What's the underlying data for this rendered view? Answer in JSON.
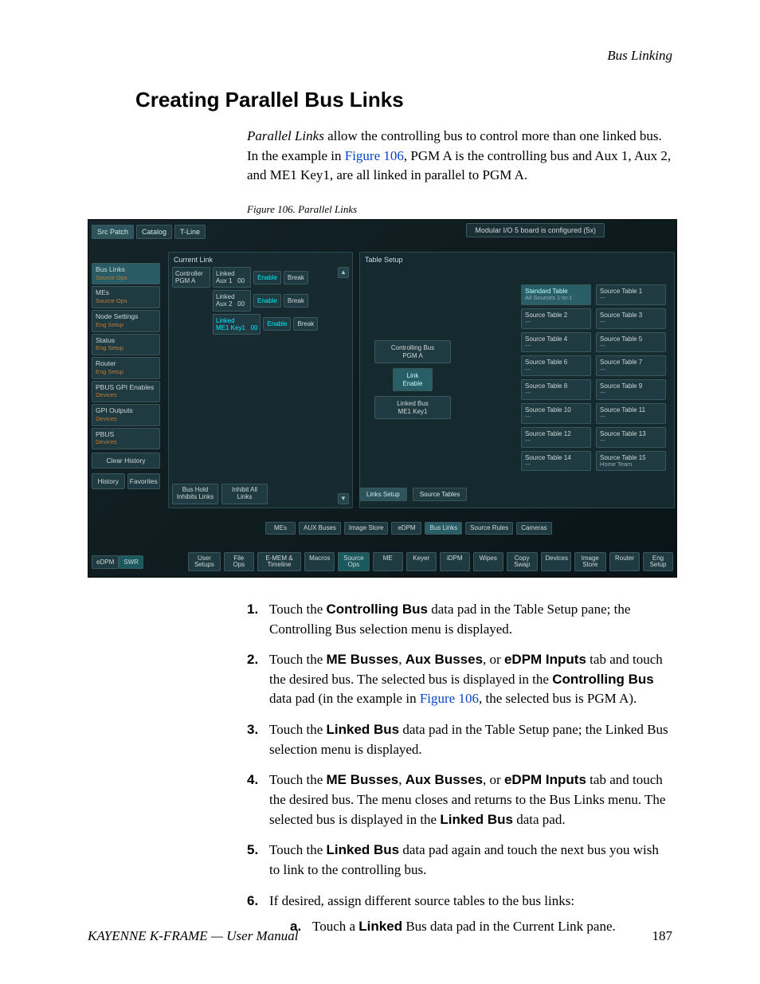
{
  "running_header": "Bus Linking",
  "section_title": "Creating Parallel Bus Links",
  "intro_parts": {
    "lead_italic": "Parallel Links",
    "after_lead": " allow the controlling bus to control more than one linked bus. In the example in ",
    "figref": "Figure 106",
    "after_figref": ", PGM A is the controlling bus and Aux 1, Aux 2, and ME1 Key1, are all linked in parallel to PGM A."
  },
  "figcaption": "Figure 106.  Parallel Links",
  "footer": {
    "left": "KAYENNE K-FRAME — User Manual",
    "right": "187"
  },
  "ui": {
    "topbar_tabs": [
      "Src Patch",
      "Catalog",
      "T-Line"
    ],
    "io_banner": "Modular I/O 5 board is configured (5x)",
    "sidebar": [
      {
        "name": "Bus Links",
        "sub": "Source Ops",
        "sel": true
      },
      {
        "name": "MEs",
        "sub": "Source Ops"
      },
      {
        "name": "Node Settings",
        "sub": "Eng Setup"
      },
      {
        "name": "Status",
        "sub": "Eng Setup"
      },
      {
        "name": "Router",
        "sub": "Eng Setup"
      },
      {
        "name": "PBUS GPI Enables",
        "sub": "Devices"
      },
      {
        "name": "GPI Outputs",
        "sub": "Devices"
      },
      {
        "name": "PBUS",
        "sub": "Devices"
      }
    ],
    "sidebar_footer": {
      "clear": "Clear History",
      "history": "History",
      "favorites": "Favorites"
    },
    "currentlink": {
      "label": "Current Link",
      "controller": {
        "title": "Controller",
        "bus": "PGM A"
      },
      "rows": [
        {
          "title": "Linked",
          "bus": "Aux 1",
          "idx": "00",
          "enable": "Enable",
          "break": "Break"
        },
        {
          "title": "Linked",
          "bus": "Aux 2",
          "idx": "00",
          "enable": "Enable",
          "break": "Break"
        },
        {
          "title": "Linked",
          "bus": "ME1 Key1",
          "idx": "00",
          "enable": "Enable",
          "break": "Break"
        }
      ],
      "footer": {
        "bushold": "Bus Hold Inhibits Links",
        "inhibit": "Inhibit All Links"
      }
    },
    "tablesetup": {
      "label": "Table Setup",
      "controlling": {
        "title": "Controlling Bus",
        "bus": "PGM A"
      },
      "link_enable": "Link Enable",
      "linkedbus": {
        "title": "Linked Bus",
        "bus": "ME1 Key1"
      },
      "source_tables": [
        {
          "name": "Standard Table",
          "sub": "All Sources 1-to-1",
          "sel": true
        },
        {
          "name": "Source Table 1",
          "sub": "---"
        },
        {
          "name": "Source Table 2",
          "sub": "---"
        },
        {
          "name": "Source Table 3",
          "sub": "---"
        },
        {
          "name": "Source Table 4",
          "sub": "---"
        },
        {
          "name": "Source Table 5",
          "sub": "---"
        },
        {
          "name": "Source Table 6",
          "sub": "---"
        },
        {
          "name": "Source Table 7",
          "sub": "---"
        },
        {
          "name": "Source Table 8",
          "sub": "---"
        },
        {
          "name": "Source Table 9",
          "sub": "---"
        },
        {
          "name": "Source Table 10",
          "sub": "---"
        },
        {
          "name": "Source Table 11",
          "sub": "---"
        },
        {
          "name": "Source Table 12",
          "sub": "---"
        },
        {
          "name": "Source Table 13",
          "sub": "---"
        },
        {
          "name": "Source Table 14",
          "sub": "---"
        },
        {
          "name": "Source Table 15",
          "sub": "Home Team"
        }
      ],
      "lower_tabs": [
        "Links Setup",
        "Source Tables"
      ]
    },
    "rowtabs": [
      "MEs",
      "AUX Buses",
      "Image Store",
      "eDPM",
      "Bus Links",
      "Source Rules",
      "Cameras"
    ],
    "rowtabs_sel": "Bus Links",
    "bottom_left": [
      "eDPM",
      "SWR"
    ],
    "bottom_right": [
      "User Setups",
      "File Ops",
      "E-MEM & Timeline",
      "Macros",
      "Source Ops",
      "ME",
      "Keyer",
      "iDPM",
      "Wipes",
      "Copy Swap",
      "Devices",
      "Image Store",
      "Router",
      "Eng Setup"
    ],
    "bottom_sel": "Source Ops"
  },
  "steps": [
    {
      "n": "1.",
      "parts": [
        "Touch the ",
        {
          "b": "Controlling Bus"
        },
        " data pad in the Table Setup pane; the Controlling Bus selection menu is displayed."
      ]
    },
    {
      "n": "2.",
      "parts": [
        "Touch the ",
        {
          "b": "ME Busses"
        },
        ", ",
        {
          "b": "Aux Busses"
        },
        ", or ",
        {
          "b": "eDPM Inputs"
        },
        " tab and touch the desired bus. The selected bus is displayed in the ",
        {
          "b": "Controlling Bus"
        },
        " data pad (in the example in ",
        {
          "a": "Figure 106"
        },
        ", the selected bus is PGM A)."
      ]
    },
    {
      "n": "3.",
      "parts": [
        "Touch the ",
        {
          "b": "Linked Bus"
        },
        " data pad in the Table Setup pane; the Linked Bus selection menu is displayed."
      ]
    },
    {
      "n": "4.",
      "parts": [
        "Touch the ",
        {
          "b": "ME Busses"
        },
        ", ",
        {
          "b": "Aux Busses"
        },
        ", or ",
        {
          "b": "eDPM Inputs"
        },
        " tab and touch the desired bus. The menu closes and returns to the Bus Links menu. The selected bus is displayed in the ",
        {
          "b": "Linked Bus"
        },
        " data pad."
      ]
    },
    {
      "n": "5.",
      "parts": [
        "Touch the ",
        {
          "b": "Linked Bus"
        },
        " data pad again and touch the next bus you wish to link to the controlling bus."
      ]
    },
    {
      "n": "6.",
      "parts": [
        "If desired, assign different source tables to the bus links:"
      ],
      "sub": {
        "n": "a.",
        "parts": [
          "Touch a ",
          {
            "b": "Linked"
          },
          " Bus data pad in the Current Link pane."
        ]
      }
    }
  ]
}
